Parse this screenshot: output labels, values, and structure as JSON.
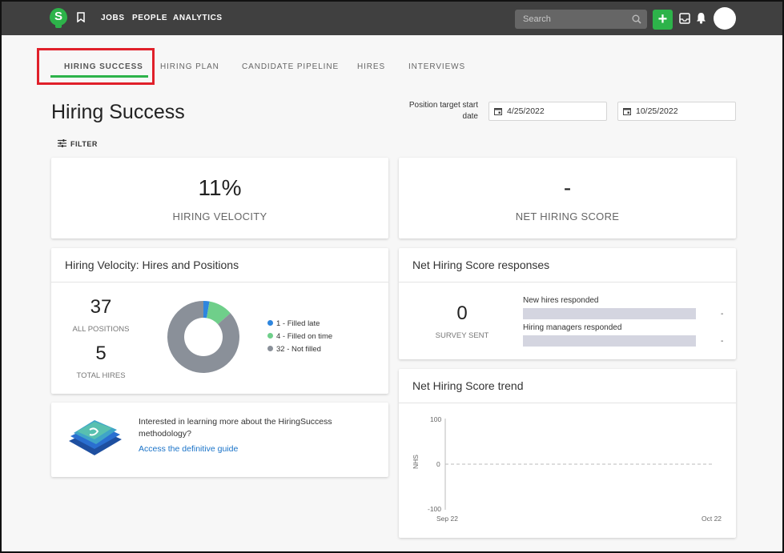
{
  "topbar": {
    "logo_letter": "S",
    "nav": [
      "JOBS",
      "PEOPLE",
      "ANALYTICS"
    ],
    "search_placeholder": "Search",
    "add_label": "+",
    "icons": [
      "bookmark-icon",
      "search-icon",
      "inbox-icon",
      "bell-icon"
    ],
    "brand_color": "#2db34a"
  },
  "tabs": [
    "HIRING SUCCESS",
    "HIRING PLAN",
    "CANDIDATE PIPELINE",
    "HIRES",
    "INTERVIEWS"
  ],
  "active_tab": "HIRING SUCCESS",
  "page": {
    "title": "Hiring Success",
    "date_label": "Position target start date",
    "start_date": "4/25/2022",
    "end_date": "10/25/2022",
    "filter_label": "FILTER"
  },
  "kpis": {
    "velocity_value": "11%",
    "velocity_label": "HIRING VELOCITY",
    "nhs_value": "-",
    "nhs_label": "NET HIRING SCORE"
  },
  "velocity_card": {
    "title": "Hiring Velocity: Hires and Positions",
    "all_positions": "37",
    "all_positions_label": "ALL POSITIONS",
    "total_hires": "5",
    "total_hires_label": "TOTAL HIRES",
    "legend": [
      "1 - Filled late",
      "4 - Filled on time",
      "32 - Not filled"
    ]
  },
  "chart_data": [
    {
      "type": "pie",
      "categories": [
        "Filled late",
        "Filled on time",
        "Not filled"
      ],
      "values": [
        1,
        4,
        32
      ],
      "colors": [
        "#2e86de",
        "#6fcf8a",
        "#8a9099"
      ],
      "donut": true
    },
    {
      "type": "line",
      "ylabel": "NHS",
      "ylim": [
        -100,
        100
      ],
      "yticks": [
        "100",
        "0",
        "-100"
      ],
      "x": [
        "Sep 22",
        "Oct 22"
      ],
      "series": [],
      "reference_line": 0
    }
  ],
  "nhs_responses": {
    "title": "Net Hiring Score responses",
    "survey_sent": "0",
    "survey_sent_label": "SURVEY SENT",
    "bars": [
      {
        "label": "New hires responded",
        "value": "-"
      },
      {
        "label": "Hiring managers responded",
        "value": "-"
      }
    ]
  },
  "guide": {
    "text": "Interested in learning more about the HiringSuccess methodology?",
    "link": "Access the definitive guide"
  },
  "trend": {
    "title": "Net Hiring Score trend"
  }
}
